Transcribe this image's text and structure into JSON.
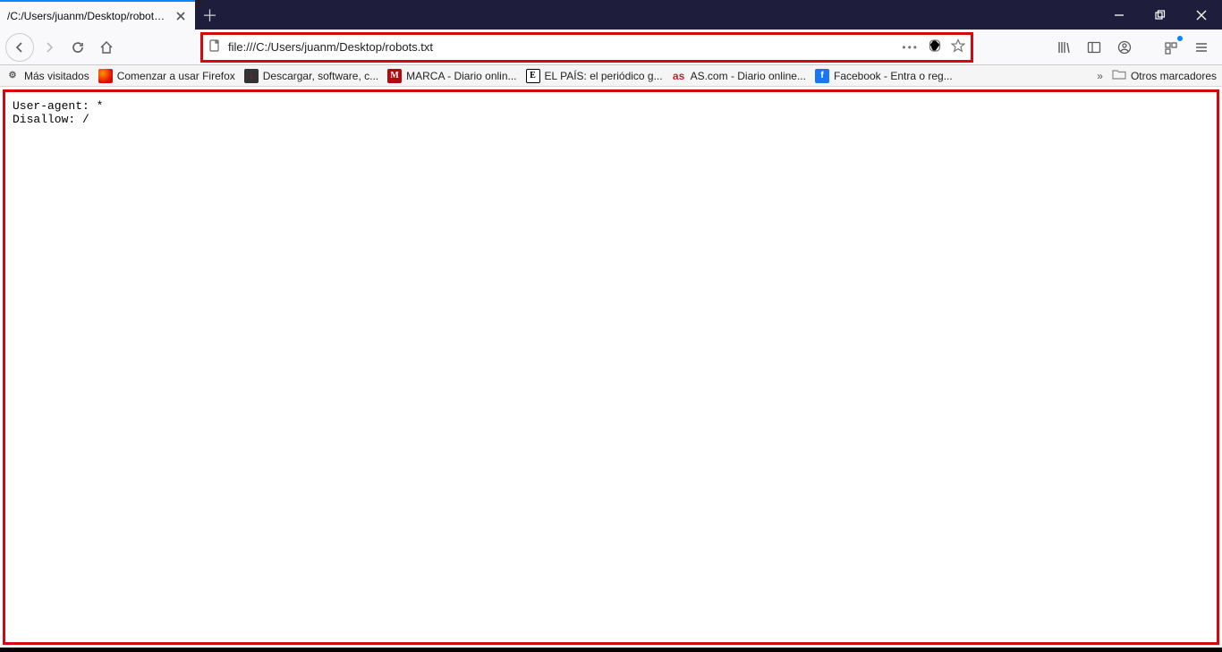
{
  "tab": {
    "title": "/C:/Users/juanm/Desktop/robots.tx"
  },
  "url": "file:///C:/Users/juanm/Desktop/robots.txt",
  "bookmarks": [
    {
      "icon": "gear",
      "label": "Más visitados"
    },
    {
      "icon": "ff",
      "label": "Comenzar a usar Firefox"
    },
    {
      "icon": "sf",
      "label": "Descargar, software, c..."
    },
    {
      "icon": "marca",
      "label": "MARCA - Diario onlin..."
    },
    {
      "icon": "elpais",
      "label": "EL PAÍS: el periódico g..."
    },
    {
      "icon": "as",
      "label": "AS.com - Diario online..."
    },
    {
      "icon": "fb",
      "label": "Facebook - Entra o reg..."
    }
  ],
  "otherBookmarks": "Otros marcadores",
  "page": {
    "text": "User-agent: *\nDisallow: /"
  },
  "favletters": {
    "gear": "⚙",
    "ff": "",
    "sf": "↓",
    "marca": "M",
    "elpais": "E",
    "as": "as",
    "fb": "f"
  }
}
